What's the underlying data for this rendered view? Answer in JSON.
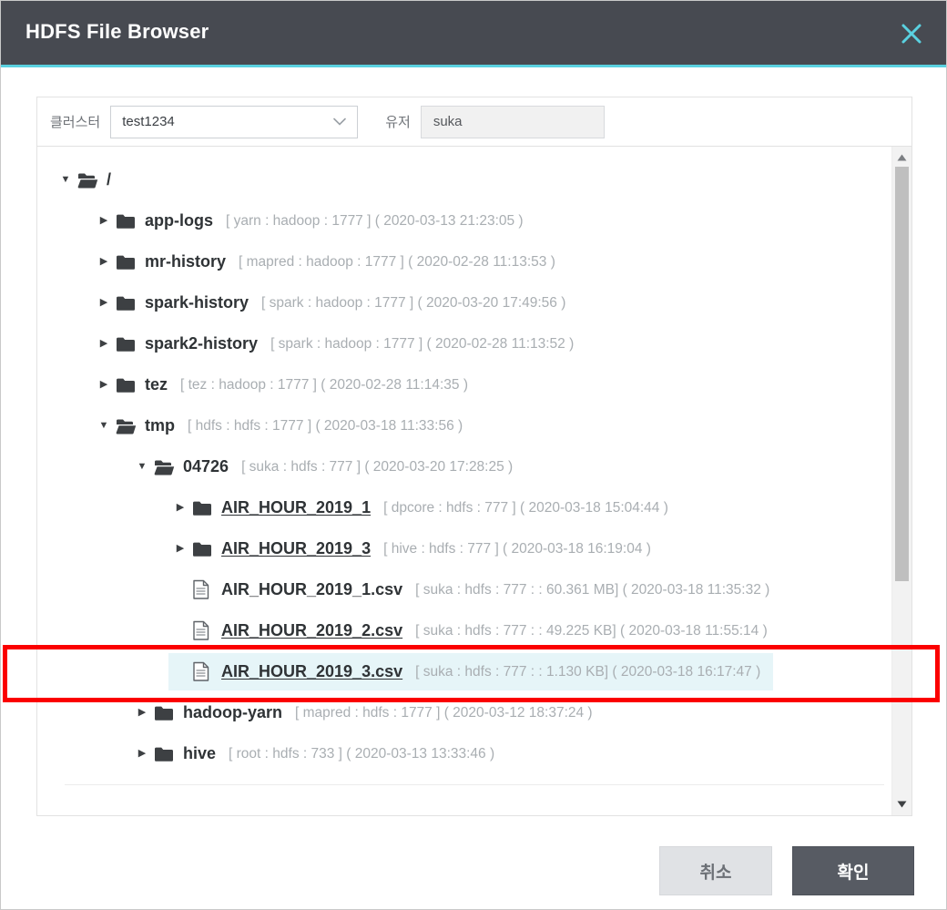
{
  "window": {
    "title": "HDFS File Browser",
    "close_icon": "close-icon",
    "accent_color": "#5ad1e0",
    "titlebar_color": "#474a51"
  },
  "filters": {
    "cluster_label": "클러스터",
    "cluster_value": "test1234",
    "cluster_chevron": "chevron-down-icon",
    "user_label": "유저",
    "user_value": "suka"
  },
  "tree": {
    "nodes": [
      {
        "name": "/",
        "meta": "",
        "depth": 0,
        "type": "folder-open",
        "caret": "▼",
        "underline": false,
        "selected": false
      },
      {
        "name": "app-logs",
        "meta": "[ yarn : hadoop : 1777 ] ( 2020-03-13 21:23:05 )",
        "depth": 1,
        "type": "folder-closed",
        "caret": "▶",
        "underline": false,
        "selected": false
      },
      {
        "name": "mr-history",
        "meta": "[ mapred : hadoop : 1777 ] ( 2020-02-28 11:13:53 )",
        "depth": 1,
        "type": "folder-closed",
        "caret": "▶",
        "underline": false,
        "selected": false
      },
      {
        "name": "spark-history",
        "meta": "[ spark : hadoop : 1777 ] ( 2020-03-20 17:49:56 )",
        "depth": 1,
        "type": "folder-closed",
        "caret": "▶",
        "underline": false,
        "selected": false
      },
      {
        "name": "spark2-history",
        "meta": "[ spark : hadoop : 1777 ] ( 2020-02-28 11:13:52 )",
        "depth": 1,
        "type": "folder-closed",
        "caret": "▶",
        "underline": false,
        "selected": false
      },
      {
        "name": "tez",
        "meta": "[ tez : hadoop : 1777 ] ( 2020-02-28 11:14:35 )",
        "depth": 1,
        "type": "folder-closed",
        "caret": "▶",
        "underline": false,
        "selected": false
      },
      {
        "name": "tmp",
        "meta": "[ hdfs : hdfs : 1777 ] ( 2020-03-18 11:33:56 )",
        "depth": 1,
        "type": "folder-open",
        "caret": "▼",
        "underline": false,
        "selected": false
      },
      {
        "name": "04726",
        "meta": "[ suka : hdfs : 777 ] ( 2020-03-20 17:28:25 )",
        "depth": 2,
        "type": "folder-open",
        "caret": "▼",
        "underline": false,
        "selected": false
      },
      {
        "name": "AIR_HOUR_2019_1",
        "meta": "[ dpcore : hdfs : 777 ] ( 2020-03-18 15:04:44 )",
        "depth": 3,
        "type": "folder-closed",
        "caret": "▶",
        "underline": true,
        "selected": false
      },
      {
        "name": "AIR_HOUR_2019_3",
        "meta": "[ hive : hdfs : 777 ] ( 2020-03-18 16:19:04 )",
        "depth": 3,
        "type": "folder-closed",
        "caret": "▶",
        "underline": true,
        "selected": false
      },
      {
        "name": "AIR_HOUR_2019_1.csv",
        "meta": "[ suka : hdfs : 777 : : 60.361 MB] ( 2020-03-18 11:35:32 )",
        "depth": 3,
        "type": "file",
        "caret": "",
        "underline": false,
        "selected": false
      },
      {
        "name": "AIR_HOUR_2019_2.csv",
        "meta": "[ suka : hdfs : 777 : : 49.225 KB] ( 2020-03-18 11:55:14 )",
        "depth": 3,
        "type": "file",
        "caret": "",
        "underline": true,
        "selected": false
      },
      {
        "name": "AIR_HOUR_2019_3.csv",
        "meta": "[ suka : hdfs : 777 : : 1.130 KB] ( 2020-03-18 16:17:47 )",
        "depth": 3,
        "type": "file",
        "caret": "",
        "underline": true,
        "selected": true
      },
      {
        "name": "hadoop-yarn",
        "meta": "[ mapred : hdfs : 1777 ] ( 2020-03-12 18:37:24 )",
        "depth": 2,
        "type": "folder-closed",
        "caret": "▶",
        "underline": false,
        "selected": false
      },
      {
        "name": "hive",
        "meta": "[ root : hdfs : 733 ] ( 2020-03-13 13:33:46 )",
        "depth": 2,
        "type": "folder-closed",
        "caret": "▶",
        "underline": false,
        "selected": false
      }
    ]
  },
  "scrollbar": {
    "up_arrow": "▲",
    "down_arrow": "▼"
  },
  "footer": {
    "cancel_label": "취소",
    "confirm_label": "확인"
  },
  "annotation": {
    "color": "#fb0000",
    "target": "AIR_HOUR_2019_3.csv"
  }
}
